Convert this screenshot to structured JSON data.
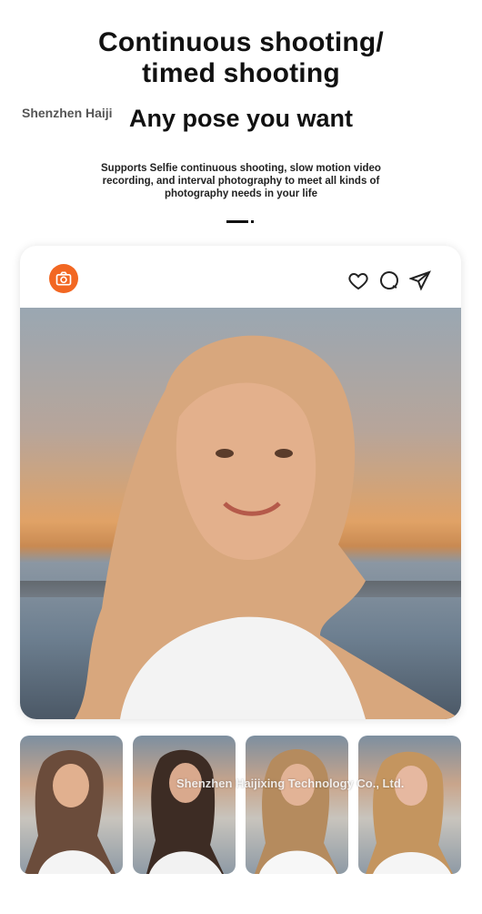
{
  "header": {
    "title_line1": "Continuous shooting/",
    "title_line2": "timed shooting",
    "subtitle": "Any pose you want",
    "description": "Supports Selfie continuous shooting, slow motion video recording, and interval photography to meet all kinds of photography needs in your life"
  },
  "watermarks": {
    "top": "Shenzhen Haiji",
    "bottom": "Shenzhen Haijixing Technology Co., Ltd."
  },
  "post_card": {
    "icons": [
      "camera-icon",
      "heart-icon",
      "comment-icon",
      "send-icon"
    ],
    "accent_color": "#f26722"
  },
  "thumbnails": [
    "thumbnail-1",
    "thumbnail-2",
    "thumbnail-3",
    "thumbnail-4"
  ]
}
